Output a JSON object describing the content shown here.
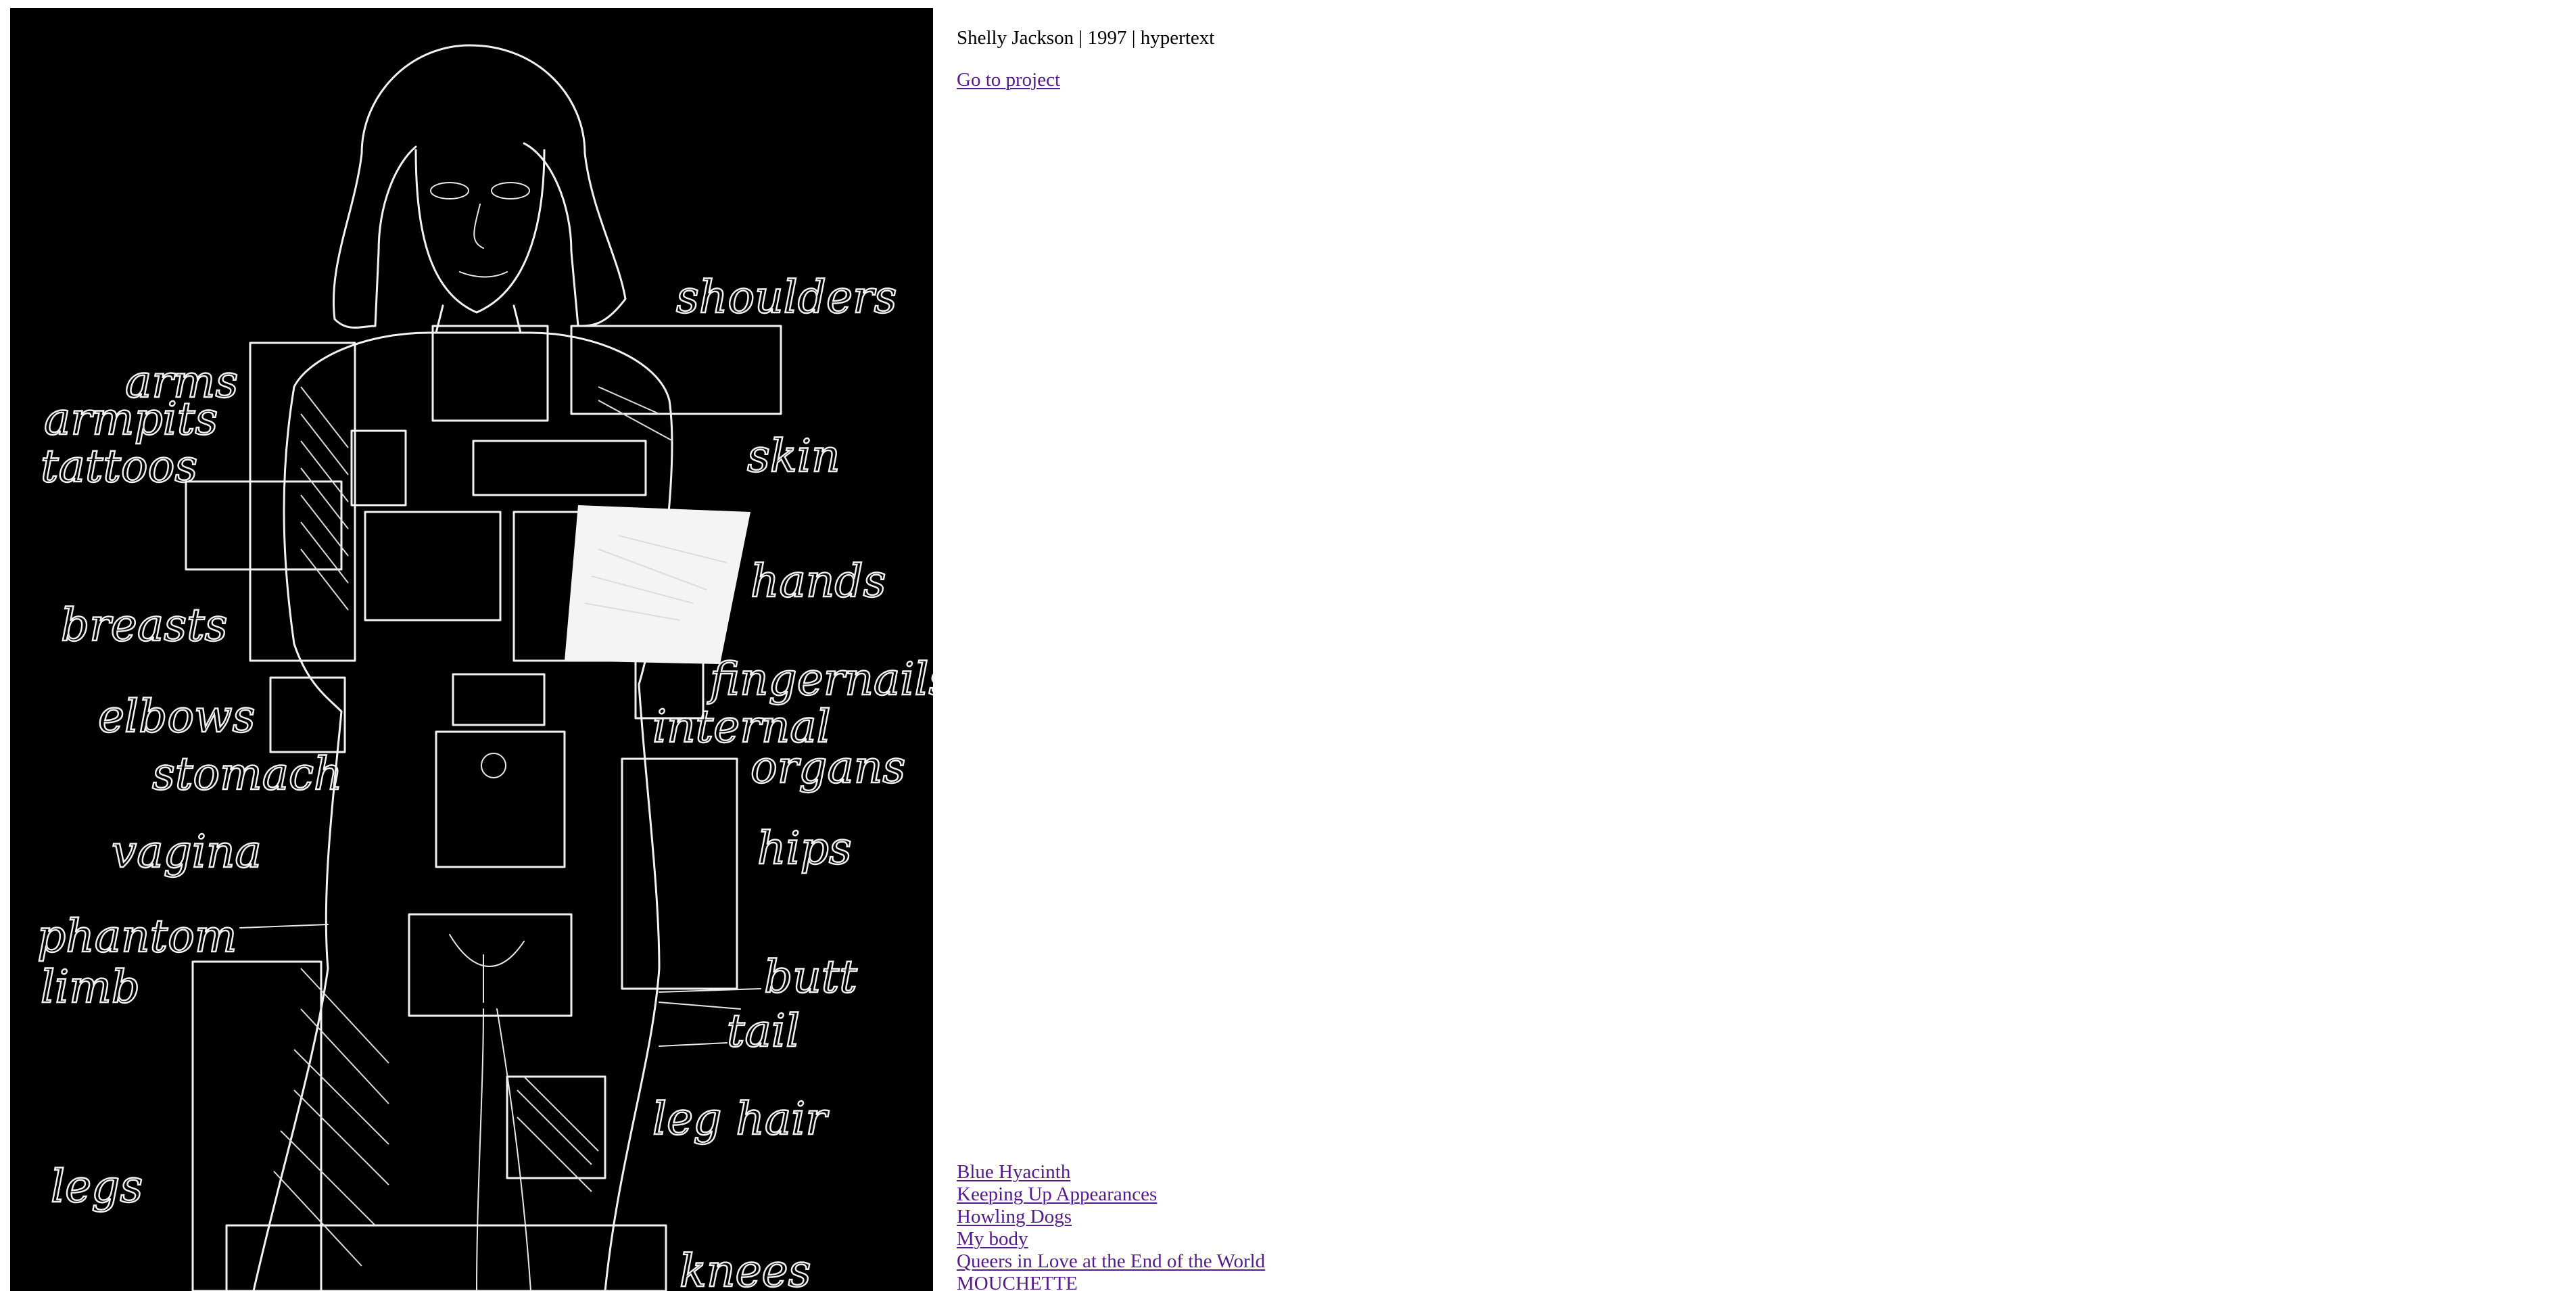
{
  "artwork": {
    "image": "hand-drawn-body-map",
    "background": "#000000",
    "line_color": "#f2f2f2",
    "labels": {
      "shoulders": "shoulders",
      "arms": "arms",
      "armpits": "armpits",
      "tattoos": "tattoos",
      "skin": "skin",
      "hands": "hands",
      "breasts": "breasts",
      "fingernails": "fingernails",
      "elbows": "elbows",
      "internal": "internal",
      "organs": "organs",
      "stomach": "stomach",
      "vagina": "vagina",
      "hips": "hips",
      "phantom": "phantom",
      "limb": "limb",
      "butt": "butt",
      "tail": "tail",
      "leg_hair": "leg hair",
      "legs": "legs",
      "knees": "knees"
    }
  },
  "info": {
    "credit": "Shelly Jackson | 1997 | hypertext",
    "project_link": "Go to project"
  },
  "projects": [
    "Blue Hyacinth",
    "Keeping Up Appearances",
    "Howling Dogs",
    "My body",
    "Queers in Love at the End of the World",
    "MOUCHETTE"
  ],
  "colors": {
    "link": "#551a8b",
    "text": "#000000",
    "page_background": "#ffffff"
  }
}
